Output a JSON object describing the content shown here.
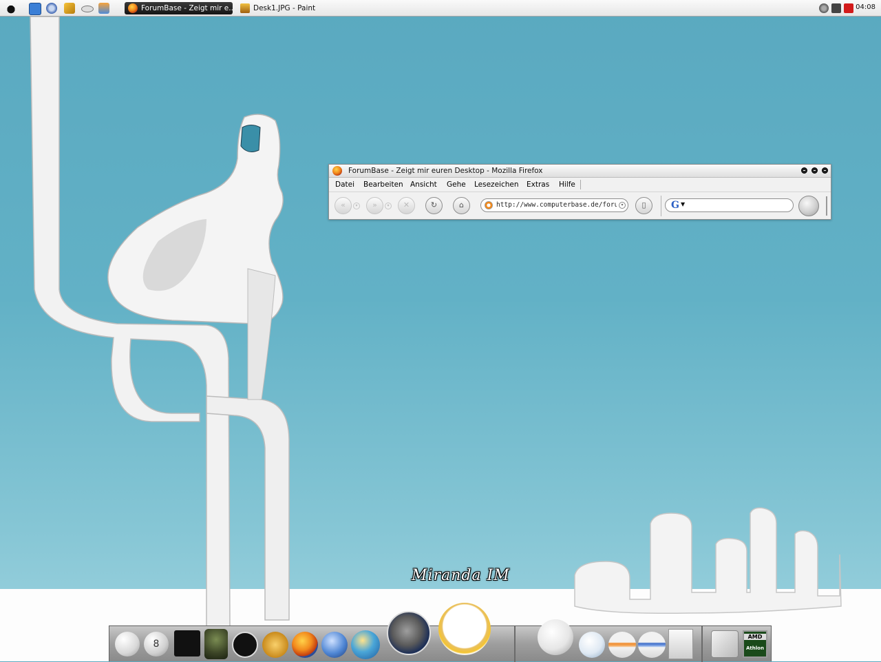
{
  "taskbar": {
    "launchers": [
      "menu-icon",
      "ie-icon",
      "network-icon",
      "pencil-icon",
      "drive-icon",
      "paint-bucket-icon"
    ],
    "tasks": [
      {
        "label": "ForumBase - Zeigt mir e...",
        "active": true,
        "icon": "firefox-icon"
      },
      {
        "label": "Desk1.JPG - Paint",
        "active": false,
        "icon": "paint-icon"
      }
    ],
    "tray_icons": [
      "shield-icon",
      "antivirus-icon",
      "kaspersky-icon"
    ],
    "clock": "04:08"
  },
  "firefox": {
    "title": "ForumBase - Zeigt mir euren Desktop - Mozilla Firefox",
    "menus": [
      "Datei",
      "Bearbeiten",
      "Ansicht",
      "Gehe",
      "Lesezeichen",
      "Extras",
      "Hilfe"
    ],
    "url": "http://www.computerbase.de/forum/",
    "search_value": "",
    "nav_buttons": [
      "back",
      "forward",
      "stop",
      "reload",
      "home",
      "bookmarks"
    ]
  },
  "desktop": {
    "hover_label": "Miranda IM"
  },
  "dock": {
    "items": [
      {
        "name": "blank-orb-icon"
      },
      {
        "name": "eight-ball-icon",
        "text": "8"
      },
      {
        "name": "steam-icon"
      },
      {
        "name": "soldier-game-icon"
      },
      {
        "name": "s-logo-icon"
      },
      {
        "name": "winamp-icon"
      },
      {
        "name": "firefox-icon"
      },
      {
        "name": "thunderbird-icon"
      },
      {
        "name": "globe-icon"
      },
      {
        "name": "gimp-icon"
      },
      {
        "name": "miranda-icon"
      },
      {
        "name": "windows-orb-icon"
      },
      {
        "name": "snowflake-orb-icon"
      },
      {
        "name": "orange-orb-icon"
      },
      {
        "name": "blue-orb-icon"
      },
      {
        "name": "document-icon"
      },
      {
        "name": "finder-icon"
      },
      {
        "name": "cpu-icon",
        "text_top": "AMD",
        "text_bottom": "Athlon"
      }
    ]
  },
  "colors": {
    "sky": "#5aa9c0",
    "floor": "#fdfdfd",
    "taskbar": "#eeeeee"
  }
}
